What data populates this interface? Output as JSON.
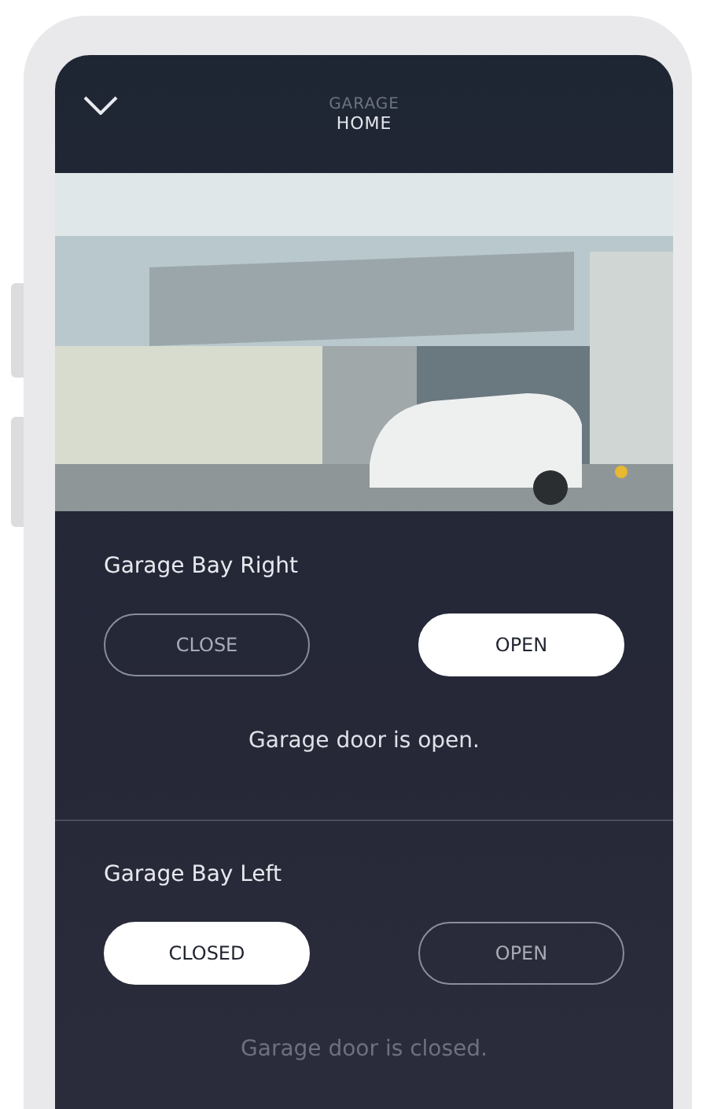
{
  "header": {
    "subtitle": "GARAGE",
    "title": "HOME"
  },
  "doors": [
    {
      "name": "Garage Bay Right",
      "buttons": [
        {
          "label": "CLOSE",
          "selected": false
        },
        {
          "label": "OPEN",
          "selected": true
        }
      ],
      "status": "Garage door is open.",
      "muted": false
    },
    {
      "name": "Garage Bay Left",
      "buttons": [
        {
          "label": "CLOSED",
          "selected": true
        },
        {
          "label": "OPEN",
          "selected": false
        }
      ],
      "status": "Garage door is closed.",
      "muted": true
    }
  ]
}
